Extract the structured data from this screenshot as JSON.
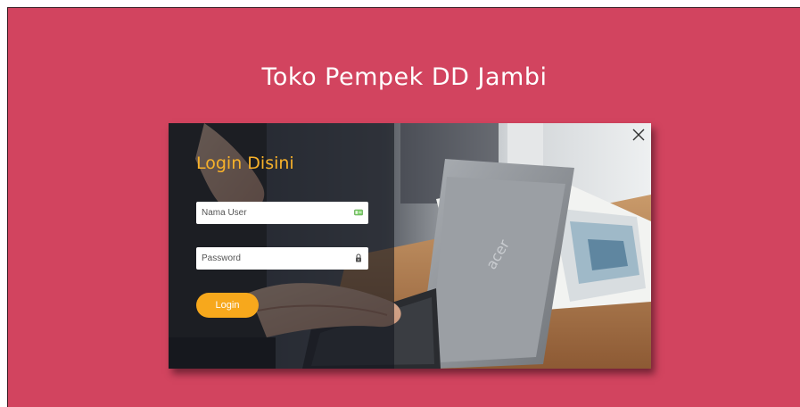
{
  "page": {
    "title": "Toko Pempek DD Jambi",
    "background_color": "#d2445f"
  },
  "login": {
    "heading": "Login Disini",
    "username_placeholder": "Nama User",
    "password_placeholder": "Password",
    "submit_label": "Login",
    "accent_color": "#f7a81c"
  },
  "icons": {
    "close": "close-icon",
    "username": "id-card-icon",
    "password": "lock-icon"
  }
}
